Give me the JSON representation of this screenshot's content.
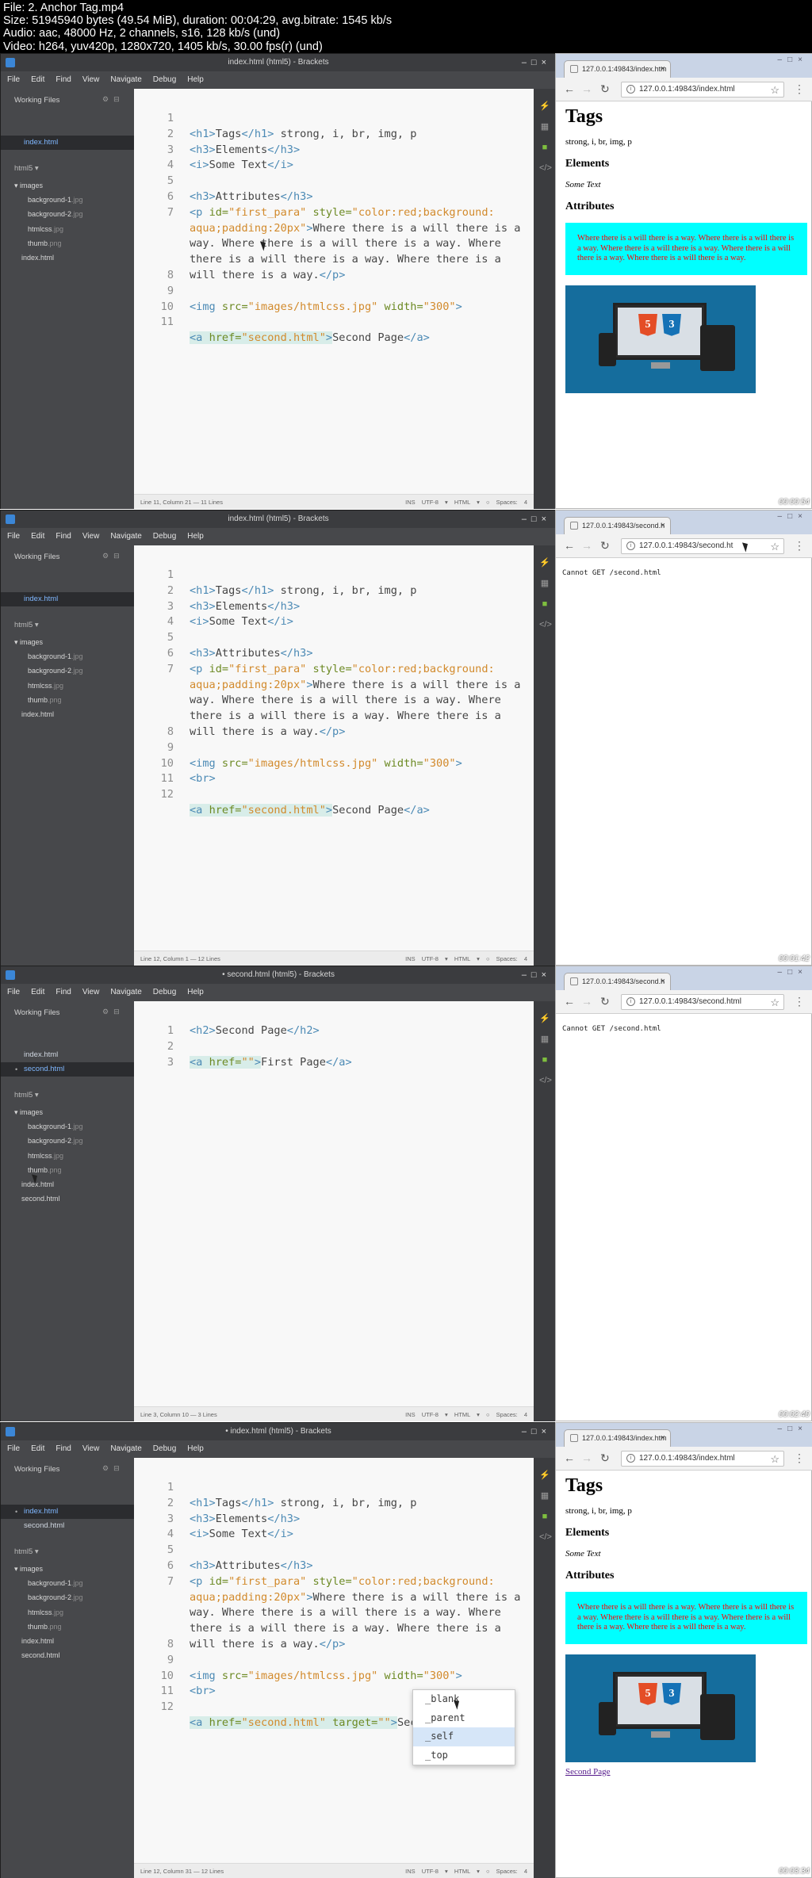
{
  "header": {
    "line1": "File: 2. Anchor Tag.mp4",
    "line2": "Size: 51945940 bytes (49.54 MiB), duration: 00:04:29, avg.bitrate: 1545 kb/s",
    "line3": "Audio: aac, 48000 Hz, 2 channels, s16, 128 kb/s (und)",
    "line4": "Video: h264, yuv420p, 1280x720, 1405 kb/s, 30.00 fps(r) (und)"
  },
  "menu": [
    "File",
    "Edit",
    "Find",
    "View",
    "Navigate",
    "Debug",
    "Help"
  ],
  "sidebar_labels": {
    "working_files": "Working Files",
    "project": "html5",
    "images_folder": "images"
  },
  "images": [
    {
      "name": "background-1",
      "ext": ".jpg"
    },
    {
      "name": "background-2",
      "ext": ".jpg"
    },
    {
      "name": "htmlcss",
      "ext": ".jpg"
    },
    {
      "name": "thumb",
      "ext": ".png"
    }
  ],
  "status_labels": {
    "ins": "INS",
    "encoding": "UTF-8 ▾",
    "lang": "HTML ▾",
    "spaces": "Spaces: 4"
  },
  "page": {
    "h1": "Tags",
    "tags_text": "strong, i, br, img, p",
    "h3_elements": "Elements",
    "italic": "Some Text",
    "h3_attributes": "Attributes",
    "para": "Where there is a will there is a way. Where there is a will there is a way. Where there is a will there is a way. Where there is a will there is a way. Where there is a will there is a way.",
    "html_badge": "5",
    "css_badge": "3",
    "link": "Second Page"
  },
  "browser": {
    "tab_title": "127.0.0.1:49843/index.htm",
    "tab_title_2": "127.0.0.1:49843/second.h"
  },
  "frames": [
    {
      "title": "index.html (html5) - Brackets",
      "working_files": [
        {
          "name": "index.html",
          "selected": true,
          "dirty": false
        }
      ],
      "project_files": [
        "index.html"
      ],
      "code_lines": 11,
      "status": "Line 11, Column 21 — 11 Lines",
      "url": "127.0.0.1:49843/index.html",
      "cannot_get": "",
      "timestamp": "00:00:54"
    },
    {
      "title": "index.html (html5) - Brackets",
      "working_files": [
        {
          "name": "index.html",
          "selected": true,
          "dirty": false
        }
      ],
      "project_files": [
        "index.html"
      ],
      "code_lines": 12,
      "status": "Line 12, Column 1 — 12 Lines",
      "url": "127.0.0.1:49843/second.ht",
      "cannot_get": "Cannot GET /second.html",
      "timestamp": "00:01:42"
    },
    {
      "title": "• second.html (html5) - Brackets",
      "working_files": [
        {
          "name": "index.html",
          "selected": false,
          "dirty": false
        },
        {
          "name": "second.html",
          "selected": true,
          "dirty": true
        }
      ],
      "project_files": [
        "index.html",
        "second.html"
      ],
      "code_lines": 3,
      "status": "Line 3, Column 10 — 3 Lines",
      "url": "127.0.0.1:49843/second.html",
      "cannot_get": "Cannot GET /second.html",
      "timestamp": "00:02:40"
    },
    {
      "title": "• index.html (html5) - Brackets",
      "working_files": [
        {
          "name": "index.html",
          "selected": true,
          "dirty": true
        },
        {
          "name": "second.html",
          "selected": false,
          "dirty": false
        }
      ],
      "project_files": [
        "index.html",
        "second.html"
      ],
      "code_lines": 12,
      "status": "Line 12, Column 31 — 12 Lines",
      "url": "127.0.0.1:49843/index.html",
      "cannot_get": "",
      "timestamp": "00:03:34"
    }
  ],
  "code": {
    "l2_text": " strong, i, br, img, p",
    "h1_open": "<h1>",
    "h1_text": "Tags",
    "h1_close": "</h1>",
    "h3_open": "<h3>",
    "h3_close": "</h3>",
    "h3a_text": "Elements",
    "h3b_text": "Attributes",
    "i_open": "<i>",
    "i_text": "Some Text",
    "i_close": "</i>",
    "p_open": "<p ",
    "id_attr": "id=",
    "id_val": "\"first_para\"",
    "style_attr": "style=",
    "style_val": "\"color:red;background: aqua;padding:20px\"",
    "gt": ">",
    "para_text": "Where there is a will there is a way. Where there is a will there is a way. Where there is a will there is a way. Where there is a will there is a way.",
    "p_close": "</p>",
    "img_open": "<img ",
    "src_attr": "src=",
    "src_val": "\"images/htmlcss.jpg\"",
    "width_attr": " width=",
    "width_val": "\"300\"",
    "br": "<br>",
    "a_open": "<a ",
    "href_attr": "href=",
    "href_val": "\"second.html\"",
    "target_attr": " target=",
    "target_val": "\"\"",
    "a_text": "Second Page",
    "a_close": "</a>",
    "s_h2_open": "<h2>",
    "s_h2_text": "Second Page",
    "s_h2_close": "</h2>",
    "s_href_val": "\"\"",
    "s_a_text": "First Page"
  },
  "autocomplete": [
    "_blank",
    "_parent",
    "_self",
    "_top"
  ],
  "colors": {
    "accent": "#7fb7ff",
    "para_bg": "#00ffff",
    "para_text": "#ff0000"
  }
}
